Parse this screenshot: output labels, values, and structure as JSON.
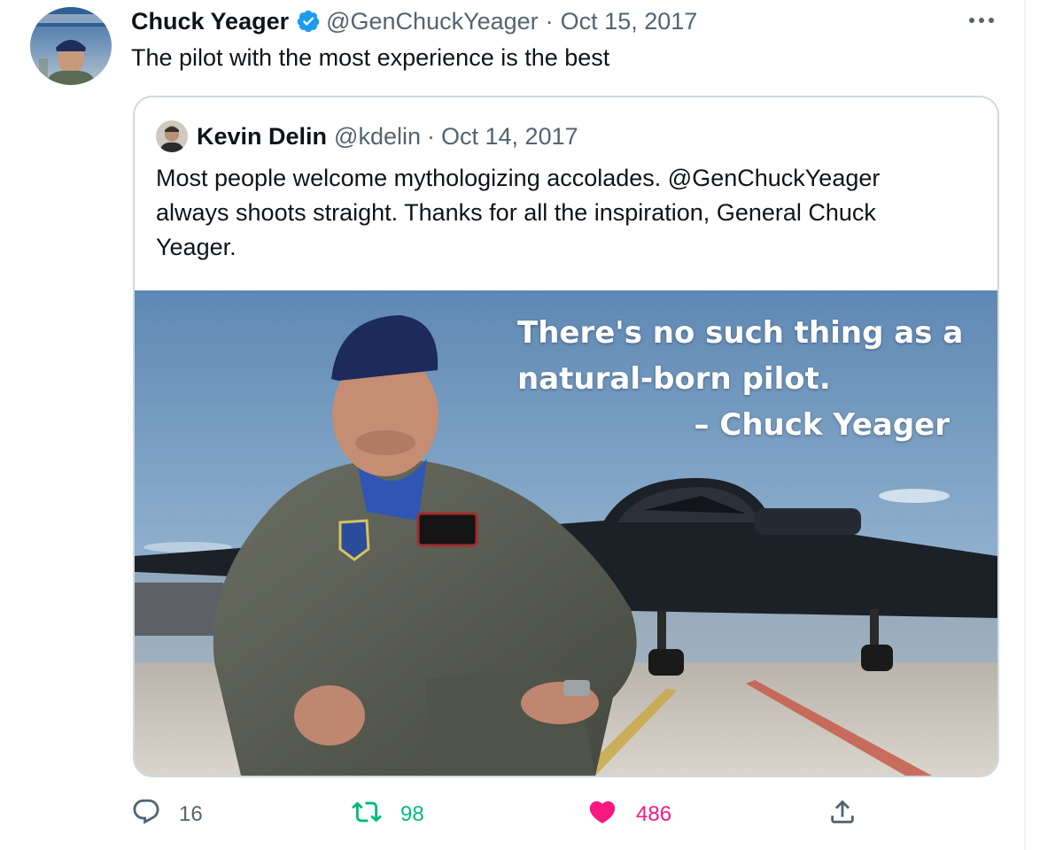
{
  "tweet": {
    "author_name": "Chuck Yeager",
    "handle": "@GenChuckYeager",
    "separator": "·",
    "date": "Oct 15, 2017",
    "text": "The pilot with the most experience is the best",
    "avatar_icon": "profile-photo-icon",
    "verified_icon": "verified-badge-icon",
    "more_icon": "more-options-icon"
  },
  "quoted": {
    "author_name": "Kevin Delin",
    "handle": "@kdelin",
    "separator": "·",
    "date": "Oct 14, 2017",
    "text": "Most people welcome mythologizing accolades. @GenChuckYeager\nalways shoots straight.  Thanks for all the inspiration, General Chuck\nYeager.",
    "media": {
      "quote_line1": "There's no such thing as a",
      "quote_line2": "natural-born pilot.",
      "attribution": "– Chuck Yeager"
    }
  },
  "actions": {
    "reply_count": "16",
    "retweet_count": "98",
    "like_count": "486",
    "reply_icon": "reply-icon",
    "retweet_icon": "retweet-icon",
    "like_icon": "heart-icon",
    "share_icon": "share-icon"
  },
  "colors": {
    "primary_text": "#0f1419",
    "secondary_text": "#536471",
    "verified": "#1d9bf0",
    "retweet": "#00ba7c",
    "like": "#f91880",
    "border": "#cfd9de"
  }
}
